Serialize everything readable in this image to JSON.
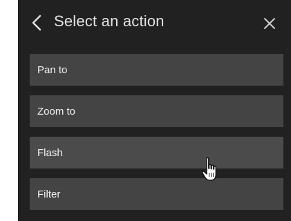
{
  "header": {
    "title": "Select an action",
    "back_icon": "chevron-left-icon",
    "close_icon": "close-icon"
  },
  "actions": [
    {
      "label": "Pan to"
    },
    {
      "label": "Zoom to"
    },
    {
      "label": "Flash"
    },
    {
      "label": "Filter"
    }
  ],
  "cursor_icon": "hand-pointer-icon",
  "colors": {
    "panel_bg": "#212121",
    "item_bg": "#444444",
    "text": "#f2f2f2",
    "title_text": "#e3e3e3"
  }
}
